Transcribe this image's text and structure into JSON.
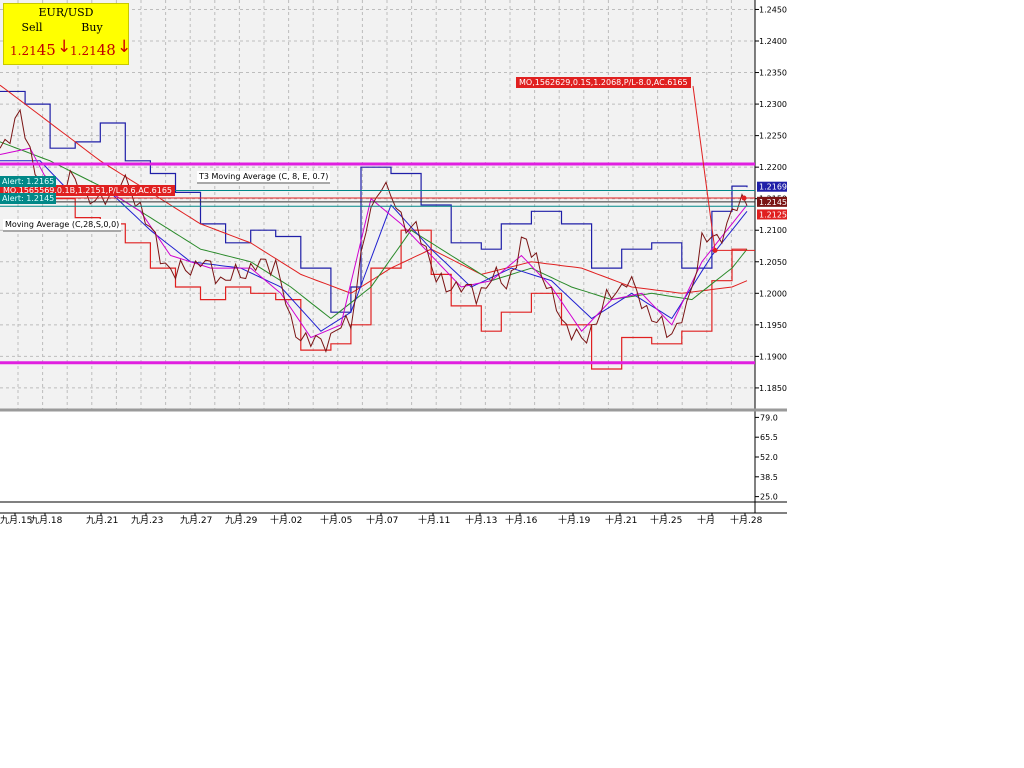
{
  "quote": {
    "pair": "EUR/USD",
    "sell_label": "Sell",
    "buy_label": "Buy",
    "sell_main": "1.21",
    "sell_big": "45",
    "buy_main": "1.21",
    "buy_big": "48",
    "arrow_icon": "arrow-down-icon",
    "arrow_color": "#d00000"
  },
  "annotations": {
    "order_top": "MO,1562629,0.1S,1.2068,P/L-8.0,AC.6165",
    "order_left": "MO,1565569,0.1B,1.2151,P/L-0.6,AC.6165",
    "alert_top": "Alert: 1.2165",
    "alert_bottom": "Alert: 1.2145",
    "t3_label": "T3 Moving Average (C, 8, E, 0.7)",
    "ma_label": "Moving Average (C,28,S,0,0)"
  },
  "colors": {
    "price": "#7a1414",
    "upper_band": "#1f1fa8",
    "lower_band": "#e02020",
    "slow_ma": "#e02020",
    "mid_ma": "#2a8a2a",
    "fast_ma": "#d000d0",
    "fast_ma2": "#2020d0",
    "hline": "#e020e0",
    "alert": "#008888",
    "order": "#e02020"
  },
  "chart_data": {
    "type": "line",
    "ylim": [
      1.1815,
      1.2465
    ],
    "yticks": [
      "1.2450",
      "1.2400",
      "1.2350",
      "1.2300",
      "1.2250",
      "1.2200",
      "1.2150",
      "1.2100",
      "1.2050",
      "1.2000",
      "1.1950",
      "1.1900",
      "1.1850"
    ],
    "xticks": [
      "九月.15",
      "九月.18",
      "九月.21",
      "九月.23",
      "九月.27",
      "九月.29",
      "十月.02",
      "十月.05",
      "十月.07",
      "十月.11",
      "十月.13",
      "十月.16",
      "十月.19",
      "十月.21",
      "十月.25",
      "十月",
      "十月.28"
    ],
    "n": 150,
    "horizontal_lines": [
      1.2205,
      1.189,
      1.2163,
      1.2151,
      1.2145,
      1.2138
    ],
    "price_badges": [
      {
        "value": "1.2169",
        "color": "#1f1fa8"
      },
      {
        "value": "1.2145",
        "color": "#7a1414"
      },
      {
        "value": "1.2125",
        "color": "#e02020"
      }
    ],
    "anchors": {
      "price": [
        [
          0,
          1.223
        ],
        [
          4,
          1.228
        ],
        [
          7,
          1.22
        ],
        [
          10,
          1.215
        ],
        [
          14,
          1.218
        ],
        [
          20,
          1.214
        ],
        [
          24,
          1.218
        ],
        [
          28,
          1.214
        ],
        [
          32,
          1.206
        ],
        [
          35,
          1.203
        ],
        [
          40,
          1.205
        ],
        [
          45,
          1.202
        ],
        [
          50,
          1.204
        ],
        [
          55,
          1.205
        ],
        [
          58,
          1.195
        ],
        [
          62,
          1.192
        ],
        [
          66,
          1.193
        ],
        [
          70,
          1.196
        ],
        [
          73,
          1.21
        ],
        [
          76,
          1.218
        ],
        [
          80,
          1.212
        ],
        [
          83,
          1.21
        ],
        [
          86,
          1.205
        ],
        [
          89,
          1.2
        ],
        [
          92,
          1.202
        ],
        [
          95,
          1.199
        ],
        [
          98,
          1.203
        ],
        [
          101,
          1.201
        ],
        [
          104,
          1.208
        ],
        [
          107,
          1.206
        ],
        [
          110,
          1.199
        ],
        [
          113,
          1.195
        ],
        [
          116,
          1.192
        ],
        [
          119,
          1.196
        ],
        [
          122,
          1.2
        ],
        [
          125,
          1.202
        ],
        [
          128,
          1.199
        ],
        [
          131,
          1.195
        ],
        [
          134,
          1.194
        ],
        [
          137,
          1.197
        ],
        [
          140,
          1.209
        ],
        [
          143,
          1.208
        ],
        [
          146,
          1.213
        ],
        [
          149,
          1.2145
        ]
      ],
      "fast_ma": [
        [
          0,
          1.222
        ],
        [
          6,
          1.223
        ],
        [
          10,
          1.217
        ],
        [
          16,
          1.216
        ],
        [
          22,
          1.216
        ],
        [
          28,
          1.213
        ],
        [
          34,
          1.206
        ],
        [
          42,
          1.204
        ],
        [
          50,
          1.204
        ],
        [
          56,
          1.2
        ],
        [
          62,
          1.193
        ],
        [
          68,
          1.195
        ],
        [
          74,
          1.215
        ],
        [
          80,
          1.211
        ],
        [
          86,
          1.206
        ],
        [
          92,
          1.201
        ],
        [
          98,
          1.202
        ],
        [
          104,
          1.206
        ],
        [
          110,
          1.201
        ],
        [
          116,
          1.194
        ],
        [
          122,
          1.199
        ],
        [
          128,
          1.2
        ],
        [
          134,
          1.195
        ],
        [
          140,
          1.205
        ],
        [
          146,
          1.211
        ],
        [
          149,
          1.214
        ]
      ],
      "fast_ma2": [
        [
          0,
          1.221
        ],
        [
          8,
          1.221
        ],
        [
          14,
          1.216
        ],
        [
          22,
          1.216
        ],
        [
          30,
          1.21
        ],
        [
          38,
          1.205
        ],
        [
          48,
          1.204
        ],
        [
          56,
          1.201
        ],
        [
          64,
          1.194
        ],
        [
          70,
          1.197
        ],
        [
          78,
          1.214
        ],
        [
          86,
          1.207
        ],
        [
          94,
          1.201
        ],
        [
          102,
          1.204
        ],
        [
          110,
          1.202
        ],
        [
          118,
          1.196
        ],
        [
          126,
          1.2
        ],
        [
          134,
          1.196
        ],
        [
          142,
          1.206
        ],
        [
          149,
          1.213
        ]
      ],
      "mid_ma": [
        [
          0,
          1.224
        ],
        [
          10,
          1.221
        ],
        [
          20,
          1.217
        ],
        [
          30,
          1.212
        ],
        [
          40,
          1.207
        ],
        [
          50,
          1.205
        ],
        [
          58,
          1.201
        ],
        [
          66,
          1.196
        ],
        [
          74,
          1.201
        ],
        [
          82,
          1.21
        ],
        [
          90,
          1.206
        ],
        [
          98,
          1.202
        ],
        [
          106,
          1.204
        ],
        [
          114,
          1.201
        ],
        [
          122,
          1.199
        ],
        [
          130,
          1.2
        ],
        [
          138,
          1.199
        ],
        [
          146,
          1.204
        ],
        [
          149,
          1.207
        ]
      ],
      "slow_ma": [
        [
          0,
          1.233
        ],
        [
          10,
          1.227
        ],
        [
          20,
          1.221
        ],
        [
          30,
          1.216
        ],
        [
          40,
          1.211
        ],
        [
          50,
          1.208
        ],
        [
          60,
          1.203
        ],
        [
          70,
          1.2
        ],
        [
          78,
          1.204
        ],
        [
          86,
          1.207
        ],
        [
          96,
          1.203
        ],
        [
          106,
          1.205
        ],
        [
          116,
          1.204
        ],
        [
          126,
          1.201
        ],
        [
          136,
          1.2
        ],
        [
          146,
          1.201
        ],
        [
          149,
          1.202
        ]
      ],
      "upper_band": [
        [
          0,
          1.232
        ],
        [
          5,
          1.23
        ],
        [
          10,
          1.223
        ],
        [
          15,
          1.224
        ],
        [
          20,
          1.227
        ],
        [
          25,
          1.221
        ],
        [
          30,
          1.219
        ],
        [
          35,
          1.216
        ],
        [
          40,
          1.211
        ],
        [
          45,
          1.208
        ],
        [
          50,
          1.21
        ],
        [
          55,
          1.209
        ],
        [
          60,
          1.204
        ],
        [
          66,
          1.197
        ],
        [
          70,
          1.201
        ],
        [
          72,
          1.22
        ],
        [
          78,
          1.219
        ],
        [
          84,
          1.214
        ],
        [
          90,
          1.208
        ],
        [
          96,
          1.207
        ],
        [
          100,
          1.211
        ],
        [
          106,
          1.213
        ],
        [
          112,
          1.211
        ],
        [
          118,
          1.204
        ],
        [
          124,
          1.207
        ],
        [
          130,
          1.208
        ],
        [
          136,
          1.204
        ],
        [
          142,
          1.213
        ],
        [
          146,
          1.217
        ],
        [
          149,
          1.2168
        ]
      ],
      "lower_band": [
        [
          0,
          1.218
        ],
        [
          5,
          1.217
        ],
        [
          10,
          1.215
        ],
        [
          15,
          1.212
        ],
        [
          20,
          1.211
        ],
        [
          25,
          1.208
        ],
        [
          30,
          1.204
        ],
        [
          35,
          1.201
        ],
        [
          40,
          1.199
        ],
        [
          45,
          1.201
        ],
        [
          50,
          1.2
        ],
        [
          55,
          1.199
        ],
        [
          60,
          1.191
        ],
        [
          66,
          1.192
        ],
        [
          70,
          1.195
        ],
        [
          74,
          1.204
        ],
        [
          80,
          1.21
        ],
        [
          86,
          1.203
        ],
        [
          90,
          1.198
        ],
        [
          96,
          1.194
        ],
        [
          100,
          1.197
        ],
        [
          106,
          1.2
        ],
        [
          112,
          1.195
        ],
        [
          118,
          1.188
        ],
        [
          124,
          1.193
        ],
        [
          130,
          1.192
        ],
        [
          136,
          1.194
        ],
        [
          142,
          1.202
        ],
        [
          146,
          1.207
        ],
        [
          149,
          1.207
        ]
      ]
    },
    "indicator_ticks": [
      "79.0",
      "65.5",
      "52.0",
      "38.5",
      "25.0"
    ],
    "indicator_ylim": [
      22,
      82
    ]
  }
}
